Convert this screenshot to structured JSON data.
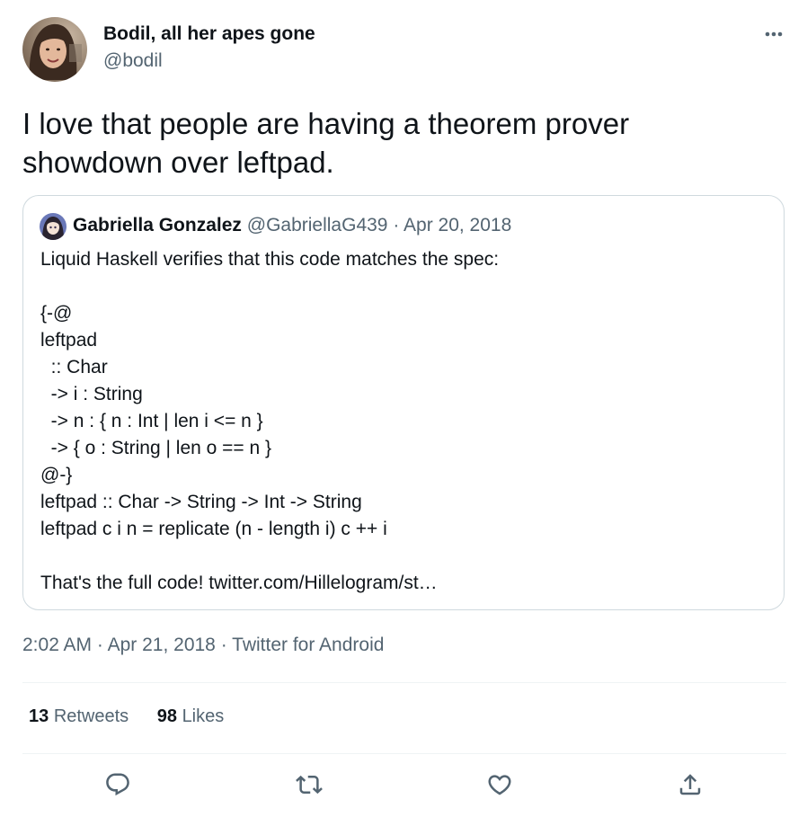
{
  "author": {
    "display_name": "Bodil, all her apes gone",
    "handle": "@bodil",
    "avatar_icon": "user-avatar-photo"
  },
  "tweet": {
    "text": "I love that people are having a theorem prover showdown over leftpad."
  },
  "quote": {
    "display_name": "Gabriella Gonzalez",
    "handle": "@GabriellaG439",
    "separator": "·",
    "date": "Apr 20, 2018",
    "lines": [
      "Liquid Haskell verifies that this code matches the spec:",
      "",
      "{-@",
      "leftpad",
      "  :: Char",
      "  -> i : String",
      "  -> n : { n : Int | len i <= n }",
      "  -> { o : String | len o == n }",
      "@-}",
      "leftpad :: Char -> String -> Int -> String",
      "leftpad c i n = replicate (n - length i) c ++ i",
      "",
      "That's the full code! twitter.com/Hillelogram/st…"
    ]
  },
  "meta": {
    "time": "2:02 AM",
    "separator": "·",
    "date": "Apr 21, 2018",
    "source": "Twitter for Android"
  },
  "stats": {
    "retweets_count": "13",
    "retweets_label": "Retweets",
    "likes_count": "98",
    "likes_label": "Likes"
  },
  "actions": {
    "icons": [
      "reply-icon",
      "retweet-icon",
      "like-icon",
      "share-icon"
    ]
  },
  "colors": {
    "text_primary": "#0f1419",
    "text_secondary": "#536471",
    "border": "#cfd9de",
    "divider": "#eff3f4"
  }
}
